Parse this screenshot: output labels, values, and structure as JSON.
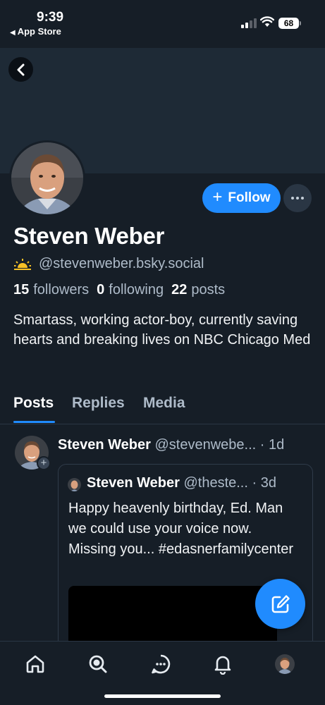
{
  "status_bar": {
    "time": "9:39",
    "back_app": "App Store",
    "battery": "68"
  },
  "profile": {
    "display_name": "Steven Weber",
    "handle": "@stevenweber.bsky.social",
    "followers_count": "15",
    "followers_label": "followers",
    "following_count": "0",
    "following_label": "following",
    "posts_count": "22",
    "posts_label": "posts",
    "bio": "Smartass, working actor-boy, currently saving hearts and breaking lives on NBC Chicago Med",
    "follow_label": "Follow"
  },
  "tabs": [
    {
      "label": "Posts",
      "active": true
    },
    {
      "label": "Replies",
      "active": false
    },
    {
      "label": "Media",
      "active": false
    }
  ],
  "post": {
    "author_name": "Steven Weber",
    "author_handle": "@stevenwebe...",
    "time": "· 1d",
    "quote": {
      "author_name": "Steven Weber",
      "author_handle": "@theste...",
      "time": "· 3d",
      "text": "Happy heavenly birthday, Ed. Man we could use your voice now. Missing you... #edasnerfamilycenter"
    }
  },
  "colors": {
    "background": "#161e27",
    "banner": "#1e2a36",
    "accent": "#208bfe",
    "muted_text": "#aebbc9"
  },
  "icons": {
    "back": "chevron-left-icon",
    "more": "ellipsis-icon",
    "compose": "compose-icon",
    "nav": [
      "home-icon",
      "search-icon",
      "chat-icon",
      "bell-icon",
      "avatar"
    ]
  }
}
